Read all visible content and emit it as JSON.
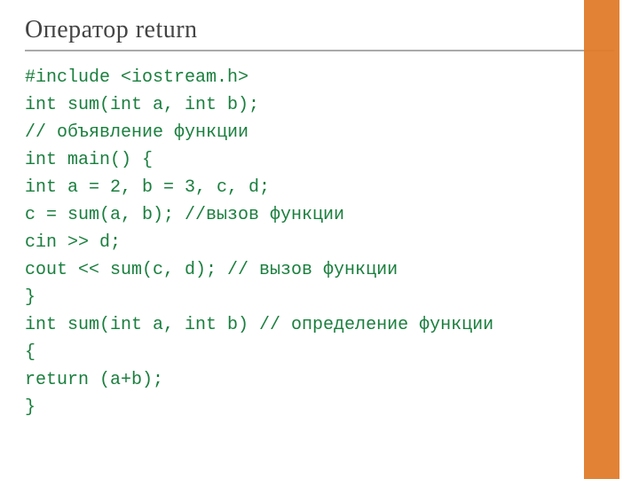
{
  "slide": {
    "title": "Оператор return"
  },
  "code": {
    "l1": "#include <iostream.h>",
    "l2": "int sum(int a, int b);",
    "l3": "// объявление функции",
    "l4": "int main() {",
    "l5": "int a = 2, b = 3, c, d;",
    "l6": "c = sum(a, b); //вызов функции",
    "l7": "cin >> d;",
    "l8": "cout << sum(c, d); // вызов функции",
    "l9": "}",
    "l10": "int sum(int a, int b) // определение функции",
    "l11": "{",
    "l12": "return (a+b);",
    "l13": "}"
  }
}
